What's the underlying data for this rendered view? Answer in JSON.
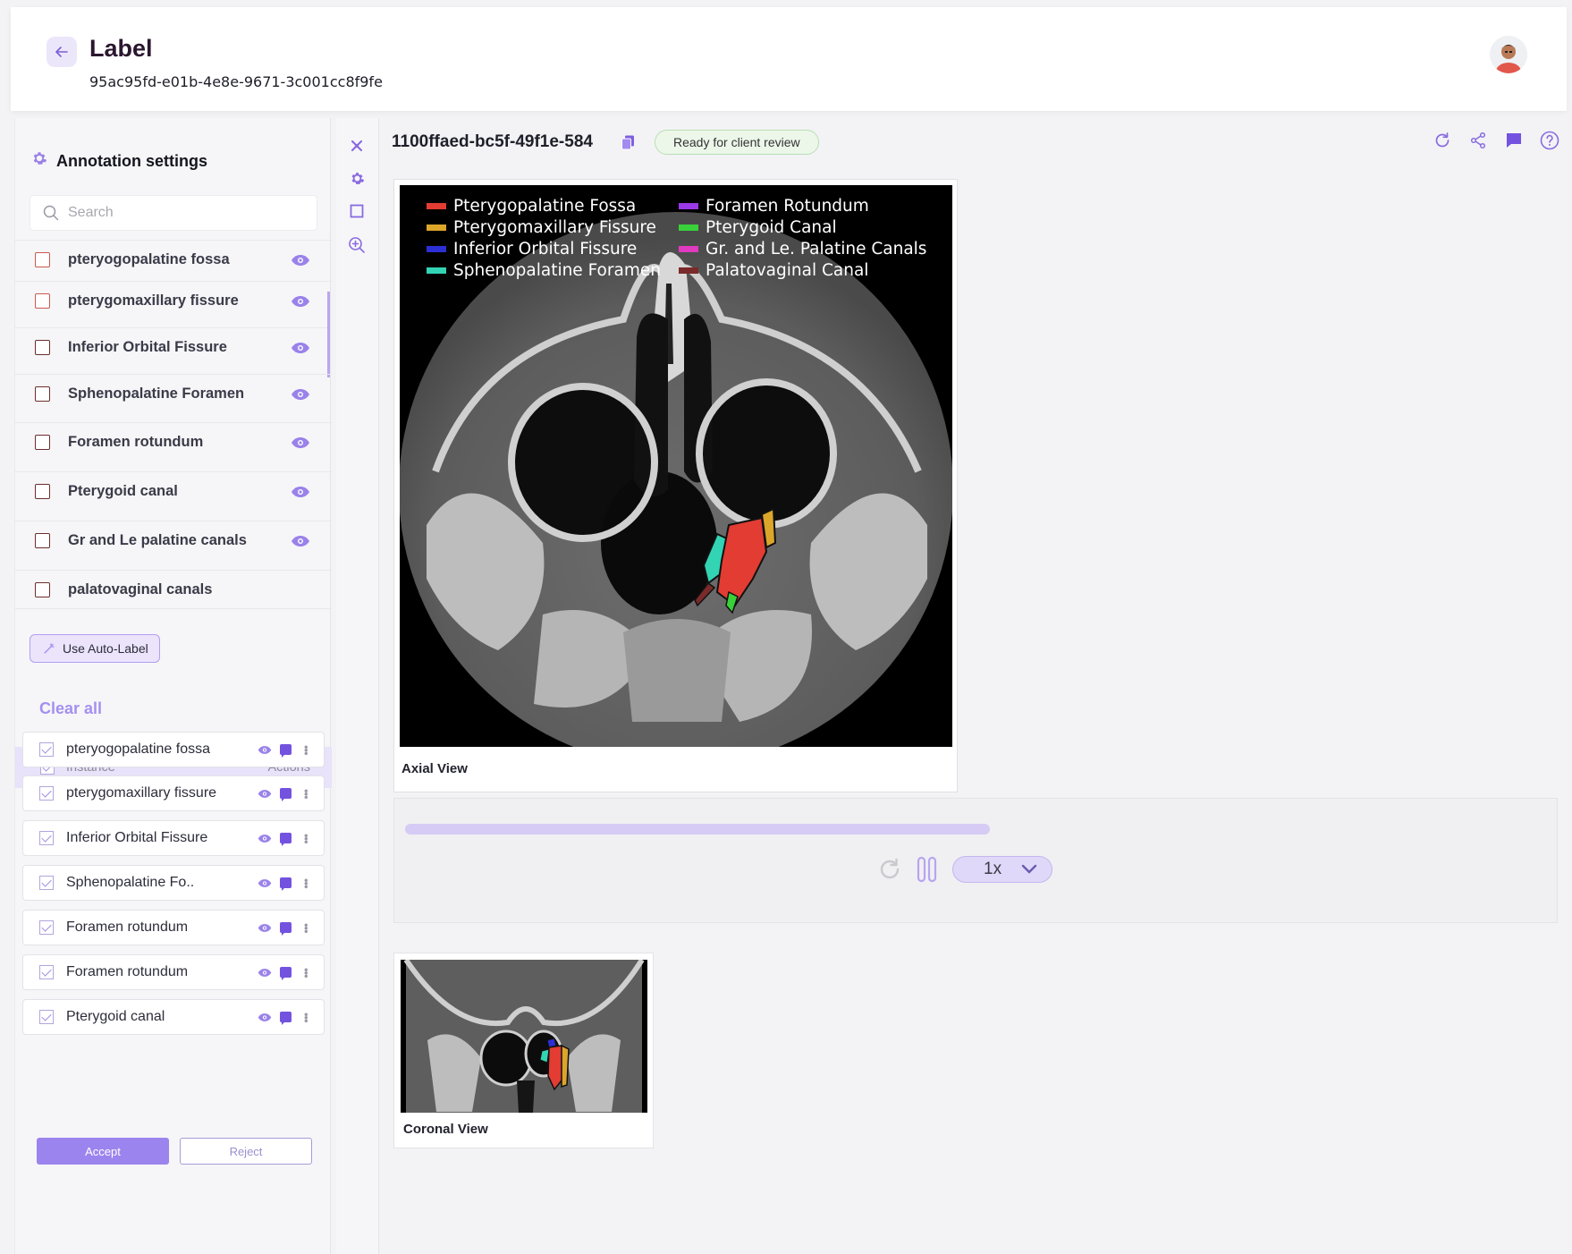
{
  "header": {
    "title": "Label",
    "subtitle": "95ac95fd-e01b-4e8e-9671-3c001cc8f9fe"
  },
  "sidebar": {
    "settings_title": "Annotation settings",
    "search_placeholder": "Search",
    "labels": [
      {
        "name": "pteryogopalatine fossa",
        "visible": true
      },
      {
        "name": "pterygomaxillary fissure",
        "visible": true
      },
      {
        "name": "Inferior Orbital Fissure",
        "visible": true
      },
      {
        "name": "Sphenopalatine Foramen",
        "visible": true
      },
      {
        "name": "Foramen rotundum",
        "visible": true
      },
      {
        "name": "Pterygoid canal",
        "visible": true
      },
      {
        "name": "Gr and Le palatine canals",
        "visible": true
      },
      {
        "name": "palatovaginal canals",
        "visible": false
      }
    ],
    "auto_label_button": "Use Auto-Label",
    "clear_all": "Clear all",
    "instances_header": {
      "instance": "Instance",
      "actions": "Actions"
    },
    "instances": [
      "pteryogopalatine fossa",
      "pterygomaxillary fissure",
      "Inferior Orbital Fissure",
      "Sphenopalatine Fo..",
      "Foramen rotundum",
      "Foramen rotundum",
      "Pterygoid canal"
    ],
    "accept": "Accept",
    "reject": "Reject"
  },
  "main": {
    "item_id": "1100ffaed-bc5f-49f1e-584",
    "status": "Ready for client review",
    "axial_label": "Axial View",
    "coronal_label": "Coronal View",
    "speed": "1x",
    "legend": [
      {
        "name": "Pterygopalatine Fossa",
        "color": "#e23c33"
      },
      {
        "name": "Foramen Rotundum",
        "color": "#9a39e8"
      },
      {
        "name": "Pterygomaxillary Fissure",
        "color": "#dba62a"
      },
      {
        "name": "Pterygoid Canal",
        "color": "#39d13a"
      },
      {
        "name": "Inferior Orbital Fissure",
        "color": "#2c2fd4"
      },
      {
        "name": "Gr. and Le. Palatine Canals",
        "color": "#e03ac0"
      },
      {
        "name": "Sphenopalatine Foramen",
        "color": "#32d4b4"
      },
      {
        "name": "Palatovaginal Canal",
        "color": "#7a2a2a"
      }
    ]
  },
  "icons": {
    "back": "arrow-left-icon",
    "settings": "gear-icon",
    "search": "search-icon",
    "eye": "eye-icon",
    "tools": [
      "crosshair-icon",
      "gear-icon",
      "square-icon",
      "zoom-in-icon"
    ],
    "top": [
      "refresh-icon",
      "share-icon",
      "comment-icon",
      "help-icon"
    ]
  },
  "colors": {
    "accent": "#9c84ee",
    "accent_light": "#ebe4fb",
    "status_bg": "#ecf7ea"
  }
}
